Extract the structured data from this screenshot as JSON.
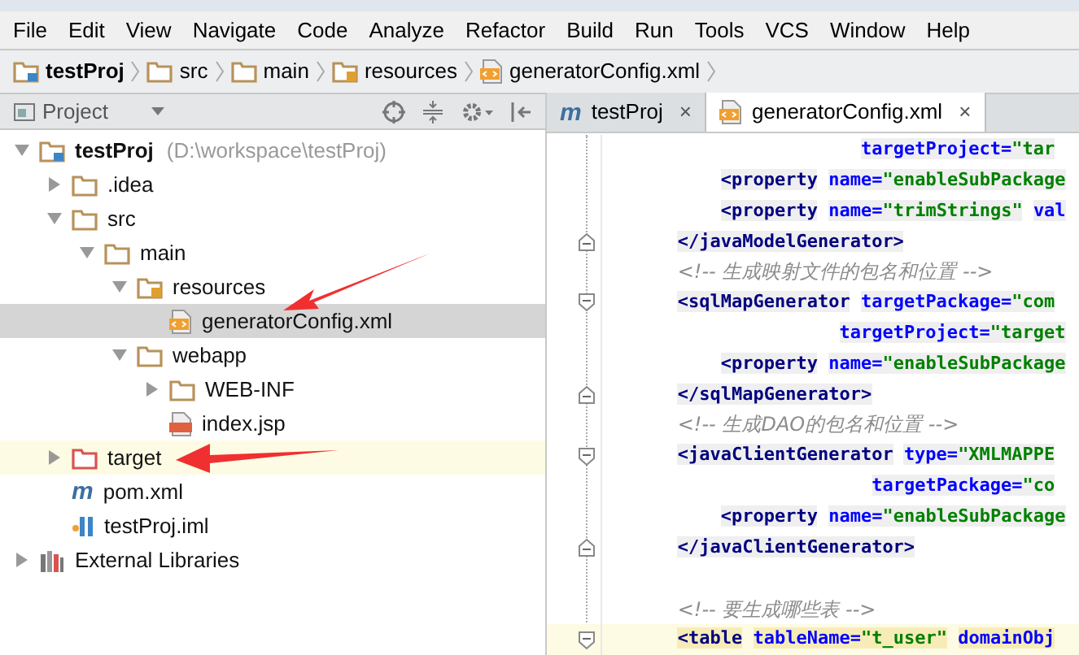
{
  "menu": [
    "File",
    "Edit",
    "View",
    "Navigate",
    "Code",
    "Analyze",
    "Refactor",
    "Build",
    "Run",
    "Tools",
    "VCS",
    "Window",
    "Help"
  ],
  "breadcrumbs": [
    {
      "label": "testProj",
      "kind": "module"
    },
    {
      "label": "src",
      "kind": "folder"
    },
    {
      "label": "main",
      "kind": "folder"
    },
    {
      "label": "resources",
      "kind": "resources"
    },
    {
      "label": "generatorConfig.xml",
      "kind": "xml"
    }
  ],
  "project_panel": {
    "title": "Project",
    "tree": [
      {
        "label": "testProj",
        "note": "(D:\\workspace\\testProj)",
        "kind": "module",
        "expanded": true,
        "selected": false,
        "children": [
          {
            "label": ".idea",
            "kind": "folder",
            "expanded": false,
            "selected": false
          },
          {
            "label": "src",
            "kind": "folder",
            "expanded": true,
            "selected": false,
            "children": [
              {
                "label": "main",
                "kind": "folder",
                "expanded": true,
                "selected": false,
                "children": [
                  {
                    "label": "resources",
                    "kind": "resources",
                    "expanded": true,
                    "selected": false,
                    "children": [
                      {
                        "label": "generatorConfig.xml",
                        "kind": "xml",
                        "selected": true
                      }
                    ]
                  },
                  {
                    "label": "webapp",
                    "kind": "folder",
                    "expanded": true,
                    "selected": false,
                    "children": [
                      {
                        "label": "WEB-INF",
                        "kind": "folder",
                        "expanded": false,
                        "selected": false
                      },
                      {
                        "label": "index.jsp",
                        "kind": "jsp",
                        "selected": false
                      }
                    ]
                  }
                ]
              }
            ]
          },
          {
            "label": "target",
            "kind": "excluded",
            "expanded": false,
            "selected": false,
            "hovered": true
          },
          {
            "label": "pom.xml",
            "kind": "maven",
            "icon": "m",
            "selected": false
          },
          {
            "label": "testProj.iml",
            "kind": "iml",
            "selected": false
          }
        ]
      },
      {
        "label": "External Libraries",
        "kind": "libraries",
        "expanded": false,
        "selected": false
      }
    ]
  },
  "tabs": [
    {
      "label": "testProj",
      "kind": "maven",
      "icon": "m",
      "close": "×",
      "selected": false
    },
    {
      "label": "generatorConfig.xml",
      "kind": "xml",
      "close": "×",
      "selected": true
    }
  ],
  "editor": {
    "lines": [
      {
        "tokens": [
          {
            "kind": "attr",
            "text": "                        targetProject="
          },
          {
            "kind": "value",
            "text": "\"tar"
          }
        ]
      },
      {
        "tokens": [
          {
            "kind": "tag",
            "text": "           <property"
          },
          {
            "kind": "attr",
            "text": " name="
          },
          {
            "kind": "value",
            "text": "\"enableSubPackage"
          }
        ]
      },
      {
        "tokens": [
          {
            "kind": "tag",
            "text": "           <property"
          },
          {
            "kind": "attr",
            "text": " name="
          },
          {
            "kind": "value",
            "text": "\"trimStrings\""
          },
          {
            "kind": "attr",
            "text": " val"
          }
        ]
      },
      {
        "fold_end": true,
        "tokens": [
          {
            "kind": "tag",
            "text": "       </javaModelGenerator>"
          }
        ]
      },
      {
        "tokens": [
          {
            "kind": "comment",
            "text": "       <!-- 生成映射文件的包名和位置 -->"
          }
        ]
      },
      {
        "fold_start": true,
        "tokens": [
          {
            "kind": "tag",
            "text": "       <sqlMapGenerator"
          },
          {
            "kind": "attr",
            "text": " targetPackage="
          },
          {
            "kind": "value",
            "text": "\"com"
          }
        ]
      },
      {
        "tokens": [
          {
            "kind": "attr",
            "text": "                      targetProject="
          },
          {
            "kind": "value",
            "text": "\"target"
          }
        ]
      },
      {
        "tokens": [
          {
            "kind": "tag",
            "text": "           <property"
          },
          {
            "kind": "attr",
            "text": " name="
          },
          {
            "kind": "value",
            "text": "\"enableSubPackage"
          }
        ]
      },
      {
        "fold_end": true,
        "tokens": [
          {
            "kind": "tag",
            "text": "       </sqlMapGenerator>"
          }
        ]
      },
      {
        "tokens": [
          {
            "kind": "comment",
            "text": "       <!-- 生成DAO的包名和位置 -->"
          }
        ]
      },
      {
        "fold_start": true,
        "tokens": [
          {
            "kind": "tag",
            "text": "       <javaClientGenerator"
          },
          {
            "kind": "attr",
            "text": " type="
          },
          {
            "kind": "value",
            "text": "\"XMLMAPPE"
          }
        ]
      },
      {
        "tokens": [
          {
            "kind": "attr",
            "text": "                         targetPackage="
          },
          {
            "kind": "value",
            "text": "\"co"
          }
        ]
      },
      {
        "tokens": [
          {
            "kind": "tag",
            "text": "           <property"
          },
          {
            "kind": "attr",
            "text": " name="
          },
          {
            "kind": "value",
            "text": "\"enableSubPackage"
          }
        ]
      },
      {
        "fold_end": true,
        "tokens": [
          {
            "kind": "tag",
            "text": "       </javaClientGenerator>"
          }
        ]
      },
      {
        "blank_line_before": true,
        "tokens": [
          {
            "kind": "comment",
            "text": "       <!-- 要生成哪些表 -->"
          }
        ]
      },
      {
        "fold_start": true,
        "current": true,
        "tokens": [
          {
            "kind": "tag",
            "text": "       <table"
          },
          {
            "kind": "attr",
            "text": " tableName="
          },
          {
            "kind": "value",
            "text": "\"t_user\""
          },
          {
            "kind": "attr",
            "text": " domainObj"
          }
        ]
      }
    ]
  }
}
